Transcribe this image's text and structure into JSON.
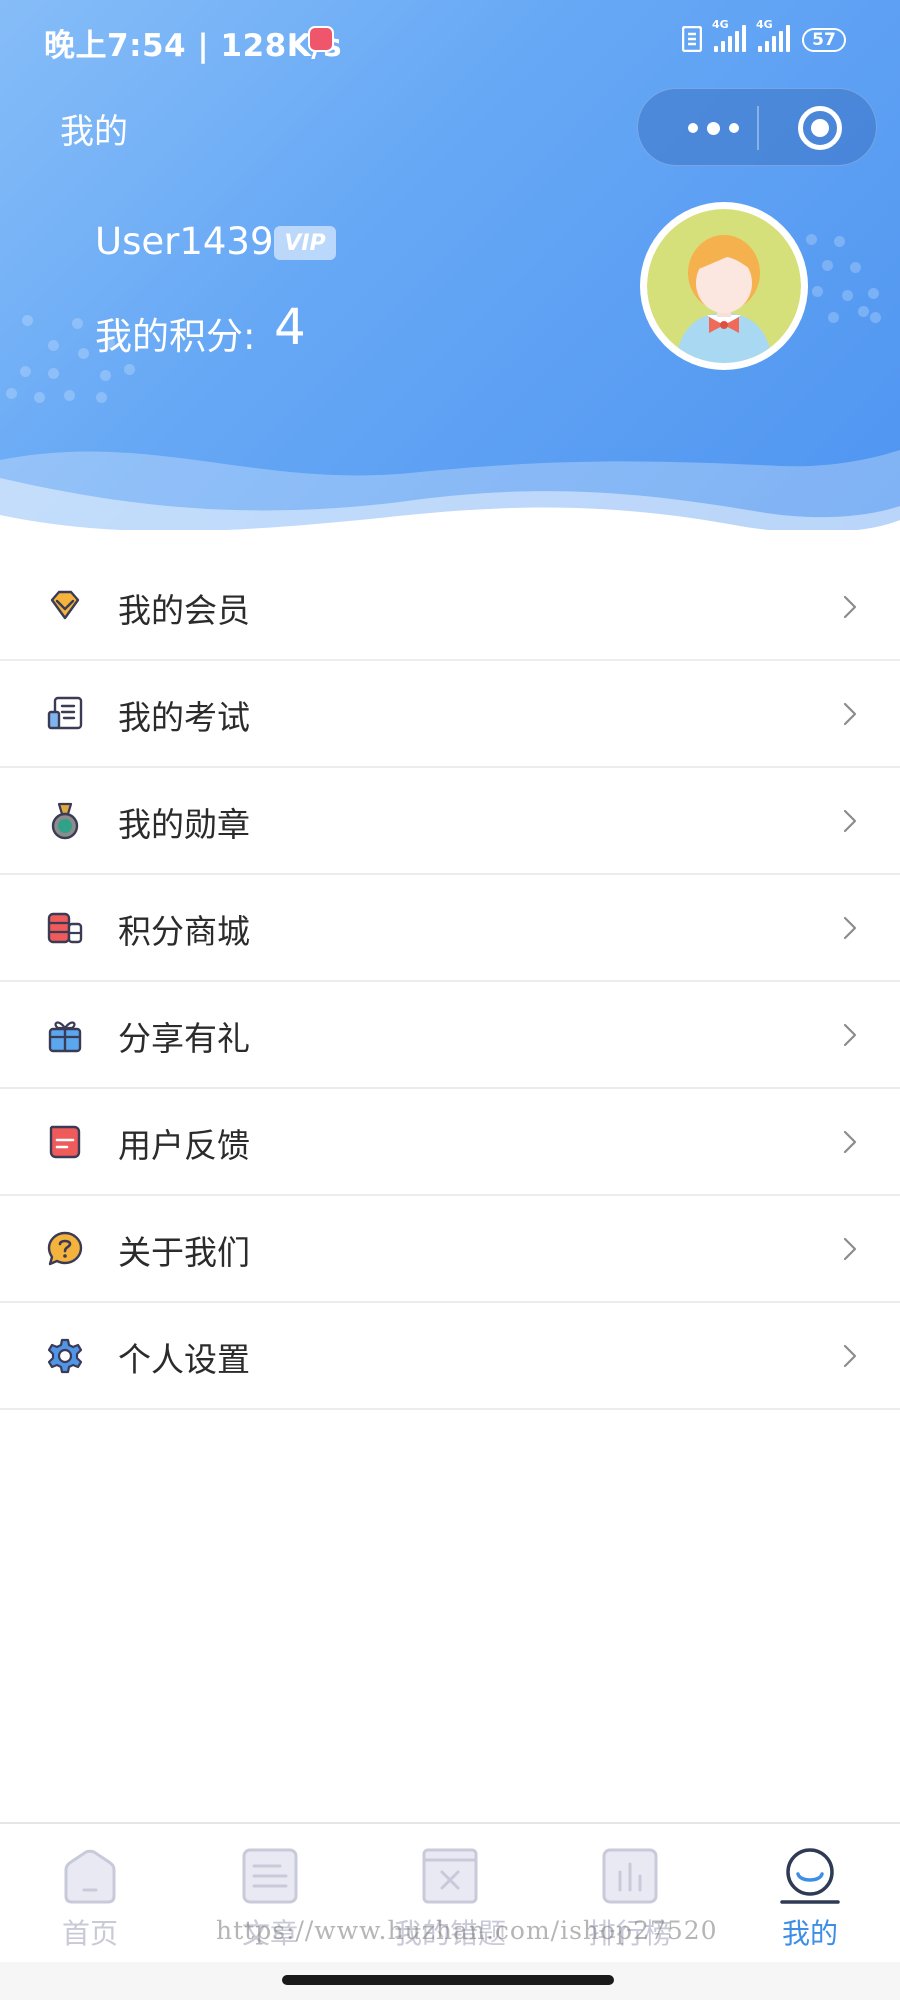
{
  "status_bar": {
    "time_speed": "晚上7:54 | 128K/s",
    "network_1": "4G",
    "network_2": "4G",
    "battery": "57"
  },
  "header": {
    "title": "我的"
  },
  "user": {
    "name": "User1439",
    "badge": "VIP",
    "points_label": "我的积分:",
    "points_value": "4"
  },
  "menu": {
    "items": [
      {
        "label": "我的会员",
        "icon": "diamond-icon"
      },
      {
        "label": "我的考试",
        "icon": "exam-paper-icon"
      },
      {
        "label": "我的勋章",
        "icon": "medal-icon"
      },
      {
        "label": "积分商城",
        "icon": "coins-icon"
      },
      {
        "label": "分享有礼",
        "icon": "gift-icon"
      },
      {
        "label": "用户反馈",
        "icon": "feedback-icon"
      },
      {
        "label": "关于我们",
        "icon": "question-bubble-icon"
      },
      {
        "label": "个人设置",
        "icon": "gear-icon"
      }
    ]
  },
  "tabbar": {
    "items": [
      {
        "label": "首页",
        "icon": "home-icon",
        "active": false
      },
      {
        "label": "文章",
        "icon": "article-icon",
        "active": false
      },
      {
        "label": "我的错题",
        "icon": "wrong-questions-icon",
        "active": false
      },
      {
        "label": "排行榜",
        "icon": "ranking-icon",
        "active": false
      },
      {
        "label": "我的",
        "icon": "profile-icon",
        "active": true
      }
    ]
  },
  "watermark": "https://www.huzhan.com/ishop27520",
  "colors": {
    "accent": "#3d8fe6",
    "header_gradient_start": "#86bdf8",
    "header_gradient_end": "#4f95f1",
    "tab_inactive": "#c9c9d8"
  }
}
